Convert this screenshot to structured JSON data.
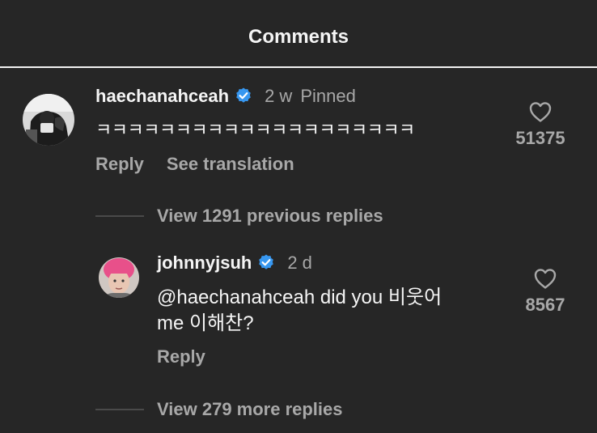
{
  "header": {
    "title": "Comments"
  },
  "comment": {
    "username": "haechanahceah",
    "verified": true,
    "age": "2 w",
    "badge": "Pinned",
    "text": "ㅋㅋㅋㅋㅋㅋㅋㅋㅋㅋㅋㅋㅋㅋㅋㅋㅋㅋㅋㅋ",
    "likes": "51375",
    "reply_label": "Reply",
    "translate_label": "See translation",
    "view_previous": "View 1291 previous replies"
  },
  "reply": {
    "username": "johnnyjsuh",
    "verified": true,
    "age": "2 d",
    "text_line1": "@haechanahceah did you 비웃어",
    "text_line2": "me 이해찬?",
    "likes": "8567",
    "reply_label": "Reply",
    "view_more": "View 279 more replies"
  },
  "colors": {
    "background": "#262626",
    "text": "#f5f5f5",
    "muted": "#a8a8a8",
    "verified": "#3797f0",
    "reply_avatar_hat": "#e8508a"
  }
}
